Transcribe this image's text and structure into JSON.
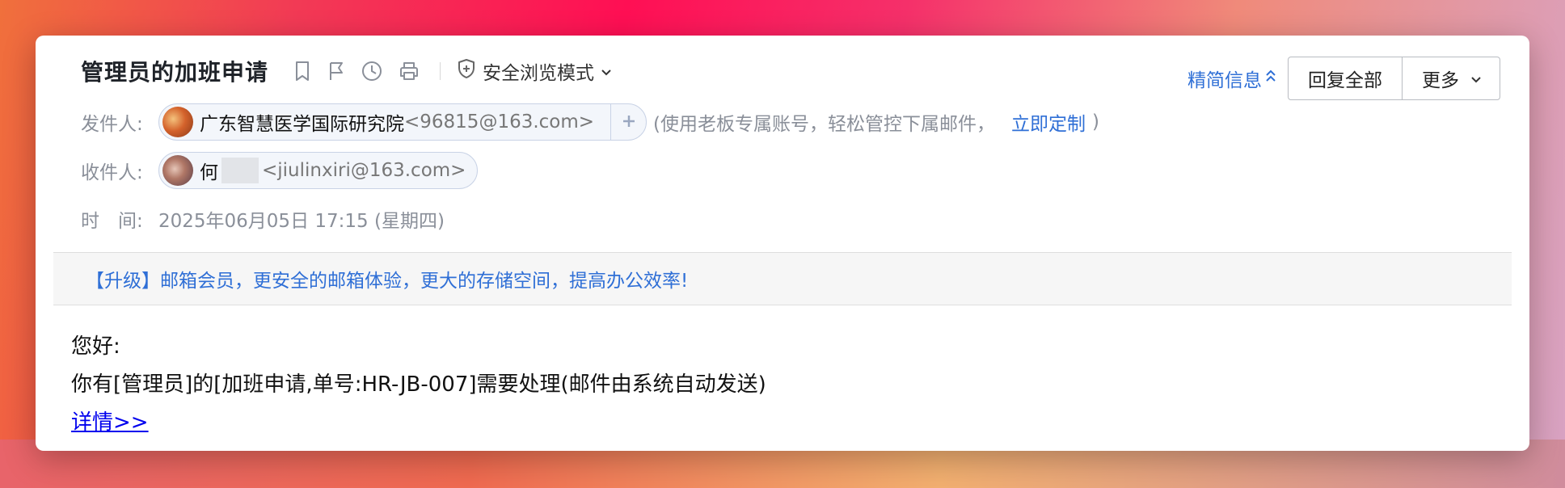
{
  "email": {
    "subject": "管理员的加班申请",
    "safe_mode_label": "安全浏览模式",
    "brief_info_label": "精简信息",
    "reply_all_label": "回复全部",
    "more_label": "更多",
    "sender": {
      "label": "发件人:",
      "name": "广东智慧医学国际研究院",
      "email": "<96815@163.com>"
    },
    "promo": {
      "text_before": "(使用老板专属账号，轻松管控下属邮件，",
      "link": "立即定制",
      "text_after": ")"
    },
    "recipient": {
      "label": "收件人:",
      "name": "何",
      "email": "<jiulinxiri@163.com>"
    },
    "time": {
      "label": "时　间:",
      "value": "2025年06月05日 17:15 (星期四)"
    },
    "banner": "【升级】邮箱会员，更安全的邮箱体验，更大的存储空间，提高办公效率!",
    "body": {
      "greeting": "您好:",
      "line": "你有[管理员]的[加班申请,单号:HR-JB-007]需要处理(邮件由系统自动发送)",
      "link": "详情>>"
    }
  },
  "icons": [
    "bookmark-icon",
    "flag-icon",
    "clock-icon",
    "print-icon",
    "shield-icon",
    "chevron-down-icon",
    "double-chevron-up-icon",
    "plus-icon"
  ],
  "colors": {
    "link": "#2f6fd6",
    "body_link": "#0000ee",
    "subject": "#1f2329"
  }
}
